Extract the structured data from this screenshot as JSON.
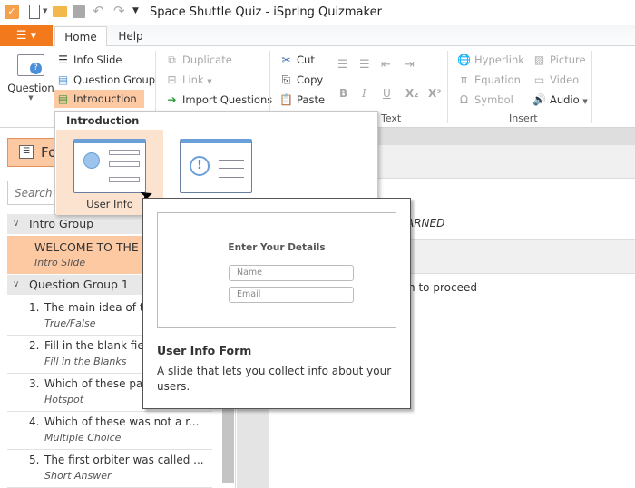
{
  "window": {
    "title": "Space Shuttle Quiz - iSpring Quizmaker"
  },
  "tabs": [
    {
      "label": "Home",
      "active": true
    },
    {
      "label": "Help"
    }
  ],
  "ribbon": {
    "question_label": "Question",
    "slides": {
      "info_slide": "Info Slide",
      "question_group": "Question Group",
      "introduction": "Introduction"
    },
    "edit": {
      "duplicate": "Duplicate",
      "link": "Link",
      "import_questions": "Import Questions"
    },
    "clipboard": {
      "cut": "Cut",
      "copy": "Copy",
      "paste": "Paste"
    },
    "text_group_label": "Text",
    "text_buttons": [
      "B",
      "I",
      "U",
      "X₂",
      "X²"
    ],
    "insert": {
      "hyperlink": "Hyperlink",
      "equation": "Equation",
      "symbol": "Symbol",
      "picture": "Picture",
      "video": "Video",
      "audio": "Audio"
    },
    "insert_group_label": "Insert"
  },
  "left": {
    "form_button": "Fo",
    "search_placeholder": "Search",
    "groups": [
      {
        "label": "Intro Group"
      },
      {
        "label": "Question Group 1"
      }
    ],
    "intro_slide": {
      "title": "WELCOME TO THE S",
      "type": "Intro Slide"
    },
    "questions": [
      {
        "num": "1.",
        "title": "The main idea of t",
        "type": "True/False"
      },
      {
        "num": "2.",
        "title": "Fill in the blank fie",
        "type": "Fill in the Blanks"
      },
      {
        "num": "3.",
        "title": "Which of these pa",
        "type": "Hotspot"
      },
      {
        "num": "4.",
        "title": "Which of these was not a r...",
        "type": "Multiple Choice"
      },
      {
        "num": "5.",
        "title": "The first orbiter was called ...",
        "type": "Short Answer"
      }
    ]
  },
  "content": {
    "row1": "ARNED",
    "row2": "ton to proceed"
  },
  "dropdown": {
    "header": "Introduction",
    "items": [
      {
        "label": "User Info",
        "selected": true
      },
      {
        "label": ""
      }
    ]
  },
  "tooltip": {
    "preview_title": "Enter Your Details",
    "name_placeholder": "Name",
    "email_placeholder": "Email",
    "title": "User Info Form",
    "description": "A slide that lets you collect info about your users."
  },
  "colors": {
    "accent": "#f27a1c",
    "selected": "#fdc9a3",
    "hover": "#fbe3cf",
    "icon_blue": "#6a9fd8"
  }
}
